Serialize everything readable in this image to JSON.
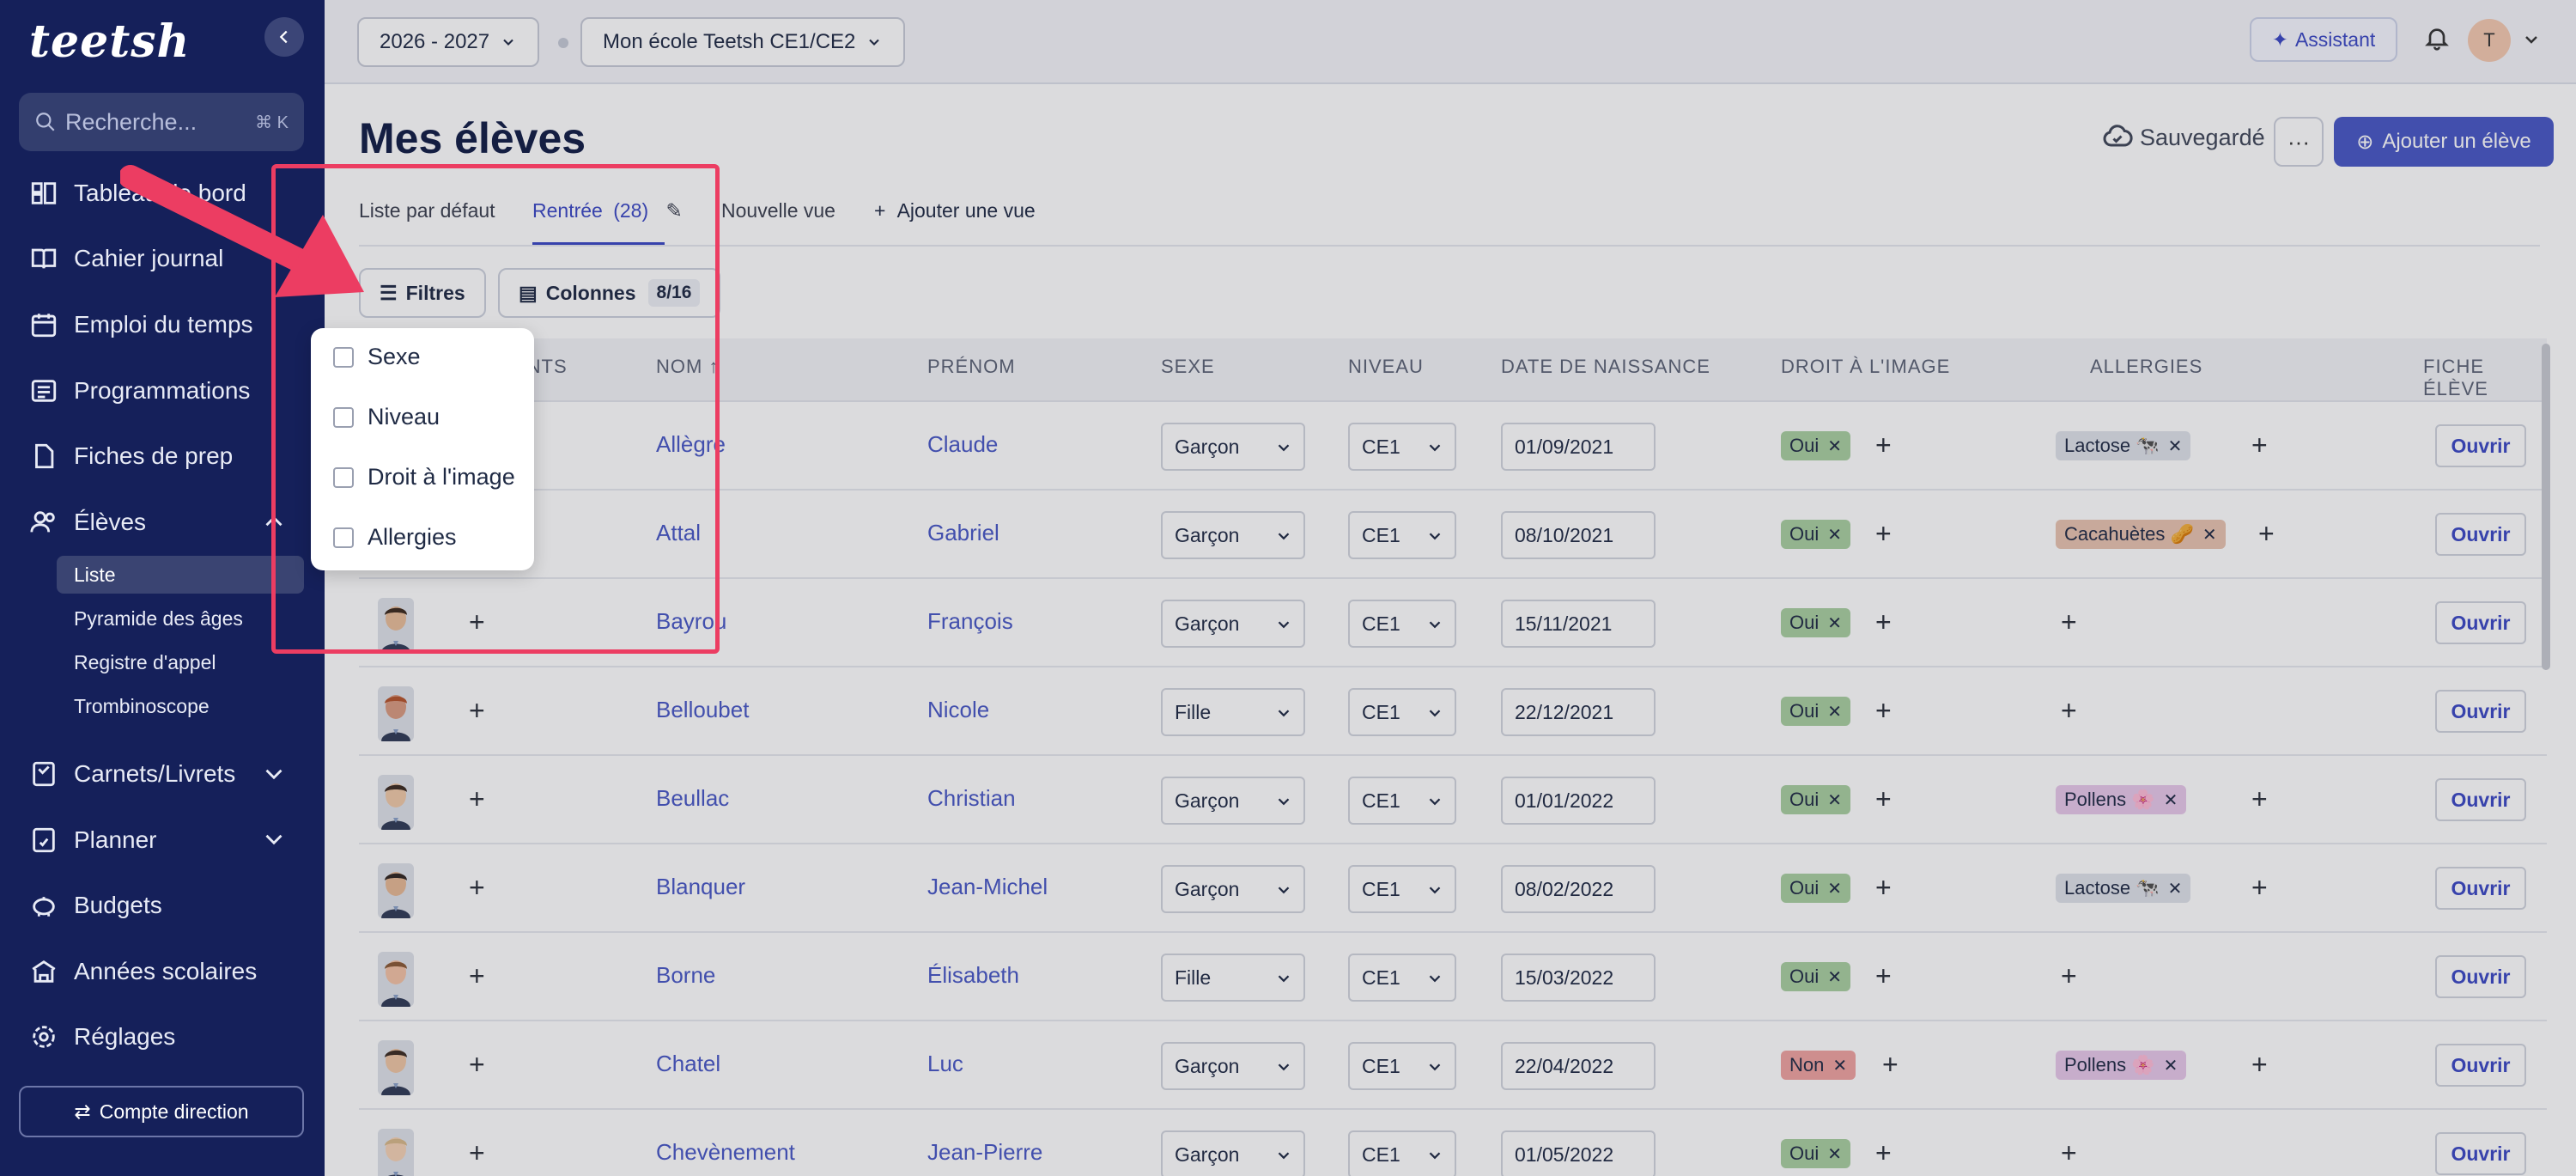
{
  "sidebar": {
    "logo": "teetsh",
    "search": {
      "placeholder": "Recherche...",
      "shortcut": "⌘ K"
    },
    "items": [
      {
        "label": "Tableau de bord",
        "icon": "dashboard-icon"
      },
      {
        "label": "Cahier journal",
        "icon": "book-icon"
      },
      {
        "label": "Emploi du temps",
        "icon": "calendar-icon"
      },
      {
        "label": "Programmations",
        "icon": "list-icon"
      },
      {
        "label": "Fiches de prep",
        "icon": "file-icon"
      },
      {
        "label": "Élèves",
        "icon": "users-icon"
      },
      {
        "label": "Carnets/Livrets",
        "icon": "notebook-icon"
      },
      {
        "label": "Planner",
        "icon": "planner-icon"
      },
      {
        "label": "Budgets",
        "icon": "piggy-bank-icon"
      },
      {
        "label": "Années scolaires",
        "icon": "school-icon"
      },
      {
        "label": "Réglages",
        "icon": "gear-icon"
      }
    ],
    "sub_items": [
      "Liste",
      "Pyramide des âges",
      "Registre d'appel",
      "Trombinoscope"
    ],
    "account_button": "Compte direction"
  },
  "topbar": {
    "year": "2026 - 2027",
    "school": "Mon école Teetsh CE1/CE2",
    "assistant": "Assistant",
    "avatar_initial": "T"
  },
  "page": {
    "title": "Mes élèves",
    "saved": "Sauvegardé",
    "more": "···",
    "add_student": "Ajouter un élève"
  },
  "views": {
    "default": "Liste par défaut",
    "rentree": "Rentrée",
    "rentree_count": "(28)",
    "new_view": "Nouvelle vue",
    "add_view": "Ajouter une vue"
  },
  "toolbar": {
    "filters": "Filtres",
    "columns": "Colonnes",
    "columns_count": "8/16"
  },
  "filter_menu": [
    "Sexe",
    "Niveau",
    "Droit à l'image",
    "Allergies"
  ],
  "table": {
    "headers": {
      "parents": "ENTS",
      "nom": "NOM",
      "prenom": "PRÉNOM",
      "sexe": "SEXE",
      "niveau": "NIVEAU",
      "naissance": "DATE DE NAISSANCE",
      "droit": "DROIT À L'IMAGE",
      "allergies": "ALLERGIES",
      "fiche": "FICHE ÉLÈVE"
    },
    "open_label": "Ouvrir",
    "rows": [
      {
        "nom": "Allègre",
        "prenom": "Claude",
        "sexe": "Garçon",
        "niveau": "CE1",
        "naissance": "01/09/2021",
        "droit": "Oui",
        "allergie": "Lactose 🐄",
        "allergie_type": "lact"
      },
      {
        "nom": "Attal",
        "prenom": "Gabriel",
        "sexe": "Garçon",
        "niveau": "CE1",
        "naissance": "08/10/2021",
        "droit": "Oui",
        "allergie": "Cacahuètes 🥜",
        "allergie_type": "caca"
      },
      {
        "nom": "Bayrou",
        "prenom": "François",
        "sexe": "Garçon",
        "niveau": "CE1",
        "naissance": "15/11/2021",
        "droit": "Oui",
        "allergie": "",
        "allergie_type": ""
      },
      {
        "nom": "Belloubet",
        "prenom": "Nicole",
        "sexe": "Fille",
        "niveau": "CE1",
        "naissance": "22/12/2021",
        "droit": "Oui",
        "allergie": "",
        "allergie_type": ""
      },
      {
        "nom": "Beullac",
        "prenom": "Christian",
        "sexe": "Garçon",
        "niveau": "CE1",
        "naissance": "01/01/2022",
        "droit": "Oui",
        "allergie": "Pollens 🌸",
        "allergie_type": "poll"
      },
      {
        "nom": "Blanquer",
        "prenom": "Jean-Michel",
        "sexe": "Garçon",
        "niveau": "CE1",
        "naissance": "08/02/2022",
        "droit": "Oui",
        "allergie": "Lactose 🐄",
        "allergie_type": "lact"
      },
      {
        "nom": "Borne",
        "prenom": "Élisabeth",
        "sexe": "Fille",
        "niveau": "CE1",
        "naissance": "15/03/2022",
        "droit": "Oui",
        "allergie": "",
        "allergie_type": ""
      },
      {
        "nom": "Chatel",
        "prenom": "Luc",
        "sexe": "Garçon",
        "niveau": "CE1",
        "naissance": "22/04/2022",
        "droit": "Non",
        "allergie": "Pollens 🌸",
        "allergie_type": "poll"
      },
      {
        "nom": "Chevènement",
        "prenom": "Jean-Pierre",
        "sexe": "Garçon",
        "niveau": "CE1",
        "naissance": "01/05/2022",
        "droit": "Oui",
        "allergie": "",
        "allergie_type": ""
      }
    ]
  },
  "colors": {
    "sidebar": "#15205a",
    "accent": "#4757c6",
    "highlight": "#ec3d62"
  }
}
